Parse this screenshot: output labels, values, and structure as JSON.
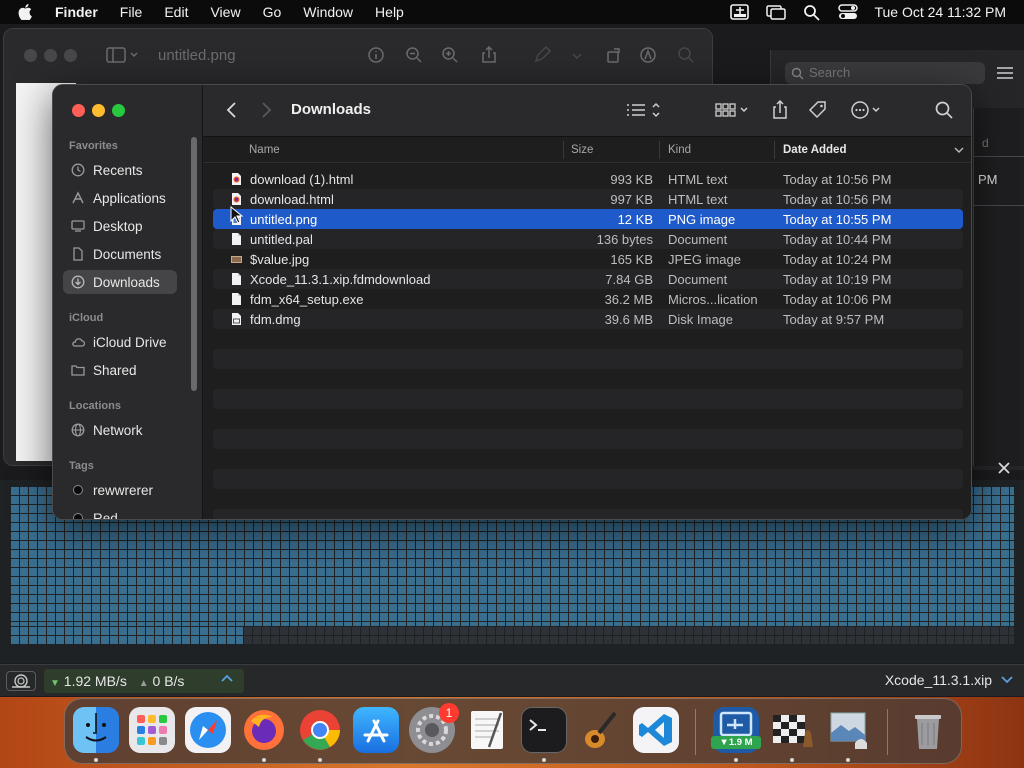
{
  "menubar": {
    "app_name": "Finder",
    "items": [
      "File",
      "Edit",
      "View",
      "Go",
      "Window",
      "Help"
    ],
    "clock": "Tue Oct 24  11:32 PM"
  },
  "preview": {
    "title": "untitled.png"
  },
  "right_window": {
    "search_placeholder": "Search",
    "header_fragment": "d",
    "time_fragment": "PM"
  },
  "finder": {
    "title": "Downloads",
    "sidebar": {
      "favorites_label": "Favorites",
      "favorites": [
        "Recents",
        "Applications",
        "Desktop",
        "Documents",
        "Downloads"
      ],
      "selected": "Downloads",
      "icloud_label": "iCloud",
      "icloud": [
        "iCloud Drive",
        "Shared"
      ],
      "locations_label": "Locations",
      "locations": [
        "Network"
      ],
      "tags_label": "Tags",
      "tags": [
        {
          "name": "rewwrerer",
          "color": "#1a1a1a"
        },
        {
          "name": "Red",
          "color": "#1a1a1a"
        }
      ]
    },
    "columns": {
      "name": "Name",
      "size": "Size",
      "kind": "Kind",
      "date": "Date Added"
    },
    "files": [
      {
        "name": "download (1).html",
        "size": "993 KB",
        "kind": "HTML text",
        "date": "Today at 10:56 PM",
        "icon": "html-file-icon",
        "selected": false
      },
      {
        "name": "download.html",
        "size": "997 KB",
        "kind": "HTML text",
        "date": "Today at 10:56 PM",
        "icon": "html-file-icon",
        "selected": false
      },
      {
        "name": "untitled.png",
        "size": "12 KB",
        "kind": "PNG image",
        "date": "Today at 10:55 PM",
        "icon": "image-file-icon",
        "selected": true
      },
      {
        "name": "untitled.pal",
        "size": "136 bytes",
        "kind": "Document",
        "date": "Today at 10:44 PM",
        "icon": "document-icon",
        "selected": false
      },
      {
        "name": "$value.jpg",
        "size": "165 KB",
        "kind": "JPEG image",
        "date": "Today at 10:24 PM",
        "icon": "jpeg-file-icon",
        "selected": false
      },
      {
        "name": "Xcode_11.3.1.xip.fdmdownload",
        "size": "7.84 GB",
        "kind": "Document",
        "date": "Today at 10:19 PM",
        "icon": "document-icon",
        "selected": false
      },
      {
        "name": "fdm_x64_setup.exe",
        "size": "36.2 MB",
        "kind": "Micros...lication",
        "date": "Today at 10:06 PM",
        "icon": "document-icon",
        "selected": false
      },
      {
        "name": "fdm.dmg",
        "size": "39.6 MB",
        "kind": "Disk Image",
        "date": "Today at 9:57 PM",
        "icon": "disk-image-icon",
        "selected": false
      }
    ]
  },
  "downloader": {
    "download_speed": "1.92 MB/s",
    "upload_speed": "0 B/s",
    "current_file": "Xcode_11.3.1.xip"
  },
  "dock": {
    "apps": [
      "finder",
      "launchpad",
      "safari",
      "firefox",
      "chrome",
      "app-store",
      "system-settings",
      "textedit",
      "terminal",
      "garageband",
      "vscode"
    ],
    "settings_badge": "1",
    "fdm_badge": "1.9 M",
    "colors": {
      "accent": "#1e5ac9"
    }
  }
}
